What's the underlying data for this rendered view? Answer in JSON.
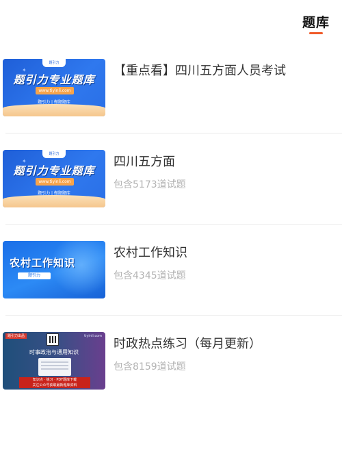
{
  "header": {
    "tab_label": "题库",
    "accent_color": "#f05a28"
  },
  "items": [
    {
      "title": "【重点看】四川五方面人员考试",
      "subtitle": "",
      "thumb": {
        "logo": "题引力",
        "slogan": "题引力专业题库",
        "url": "www.tiyinli.com",
        "tagline": "题引力 | 做题题库"
      }
    },
    {
      "title": "四川五方面",
      "subtitle": "包含5173道试题",
      "thumb": {
        "logo": "题引力",
        "slogan": "题引力专业题库",
        "url": "www.tiyinli.com",
        "tagline": "题引力 | 做题题库"
      }
    },
    {
      "title": "农村工作知识",
      "subtitle": "包含4345道试题",
      "thumb": {
        "heading": "农村工作知识",
        "chip": "题引力"
      }
    },
    {
      "title": "时政热点练习（每月更新）",
      "subtitle": "包含8159道试题",
      "thumb": {
        "badge": "题引力出品",
        "site": "tiyinli.com",
        "headline": "时事政治与通用知识",
        "banner_line1": "知识点 · 练习 · PDF题库下载",
        "banner_line2": "关注公众号获取最新题库资料"
      }
    }
  ]
}
